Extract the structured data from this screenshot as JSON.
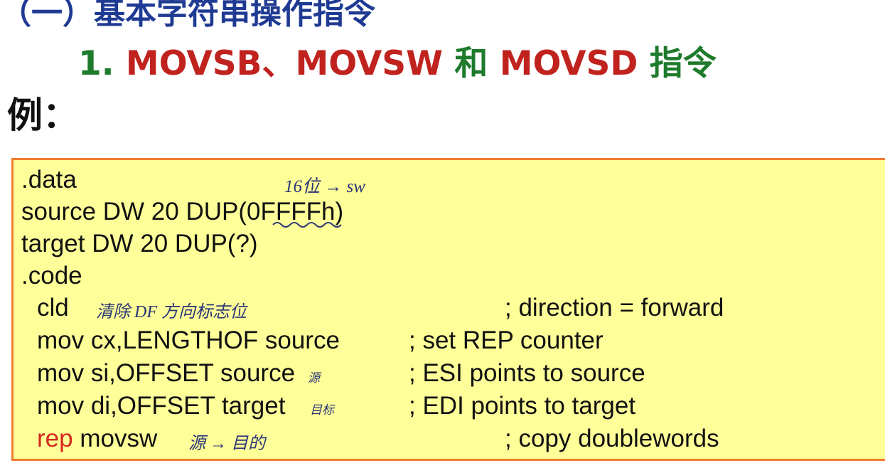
{
  "title": "（一）基本字符串操作指令",
  "subtitle": {
    "num": "1. ",
    "a": "MOVSB",
    "sep": "、",
    "b": "MOVSW",
    "and": " 和 ",
    "c": "MOVSD",
    "suffix": " 指令"
  },
  "example_label": "例：",
  "code": {
    "l1": ".data",
    "l2": "source DW 20 DUP(0FFFFh)",
    "l3": "target DW 20 DUP(?)",
    "l4": ".code",
    "l5": "cld",
    "l5c": "; direction = forward",
    "l6": "mov cx,LENGTHOF source",
    "l6c": "; set REP counter",
    "l7": "mov si,OFFSET source",
    "l7c": "; ESI points to source",
    "l8": "mov di,OFFSET target",
    "l8c": "; EDI points to target",
    "l9a": "rep",
    "l9b": " movsw",
    "l9c": "; copy doublewords"
  },
  "notes": {
    "n1": "16位 → sw",
    "n2": "清除 DF 方向标志位",
    "n3": "源",
    "n4": "目标",
    "n5": "源 → 目的"
  }
}
